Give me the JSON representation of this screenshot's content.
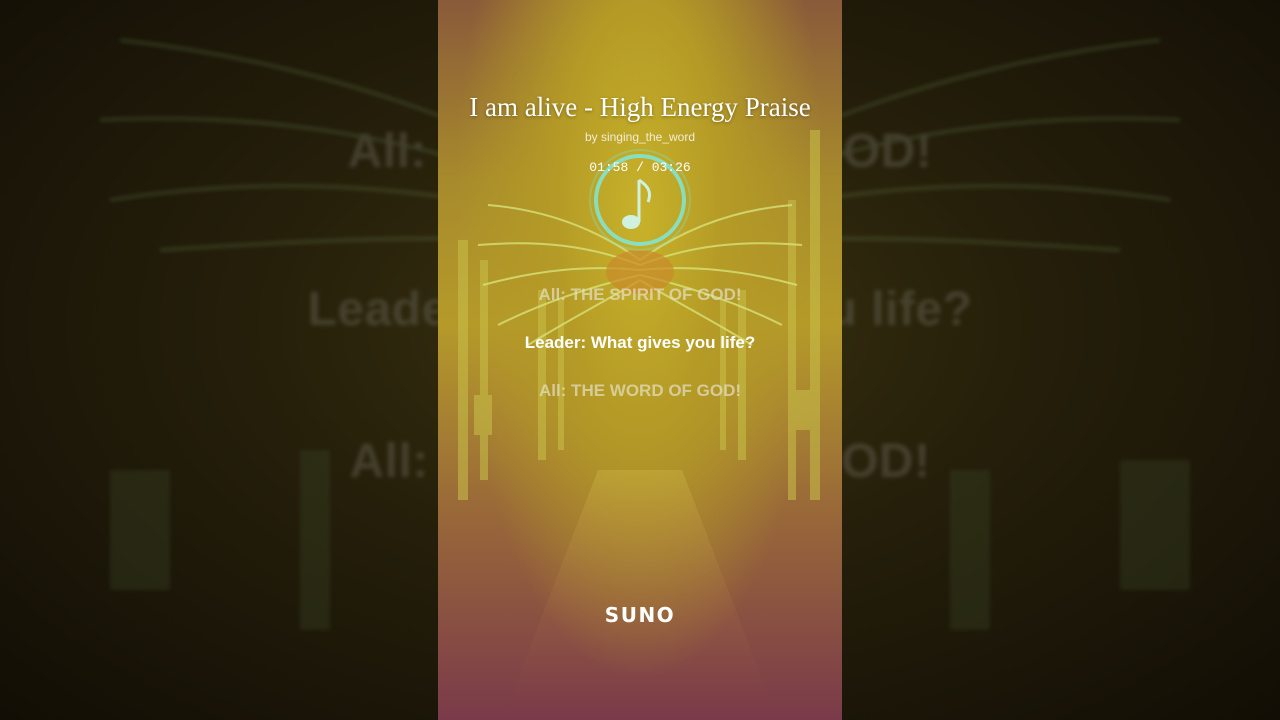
{
  "song": {
    "title": "I am alive - High Energy Praise",
    "artist": "by singing_the_word",
    "time_display": "01:58 / 03:26"
  },
  "lyrics": {
    "previous": "All: THE SPIRIT OF GOD!",
    "current": "Leader: What gives you life?",
    "next": "All: THE WORD OF GOD!"
  },
  "background_lyrics": {
    "line1": "All: THE SPIRIT OF GOD!",
    "line2": "Leader: What gives you life?",
    "line3": "All: THE WORD OF GOD!"
  },
  "brand": {
    "logo_text": "SUNO"
  },
  "colors": {
    "accent_glow": "#7ee8d8",
    "card_yellow": "#b59a2a",
    "card_bottom": "#7a3a4a"
  },
  "icons": {
    "music_note": "music-note-icon",
    "winged_emblem": "winged-emblem-icon"
  }
}
